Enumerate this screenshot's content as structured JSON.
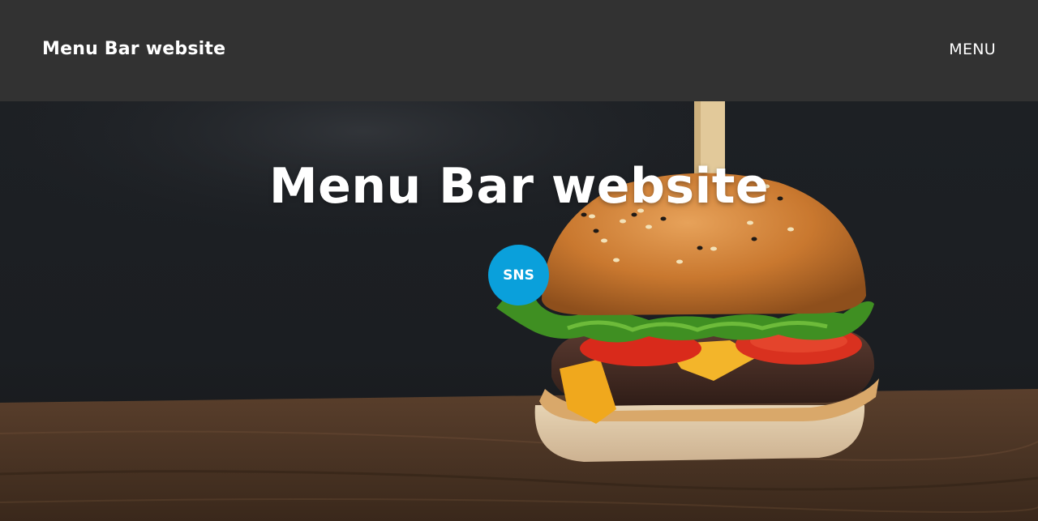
{
  "header": {
    "site_title": "Menu Bar website",
    "menu_label": "MENU"
  },
  "hero": {
    "title": "Menu Bar website",
    "image_subject": "burger-photo"
  },
  "sns": {
    "label": "SNS"
  },
  "colors": {
    "header_background": "#323232",
    "sns_button": "#0aa0db",
    "text": "#ffffff"
  }
}
